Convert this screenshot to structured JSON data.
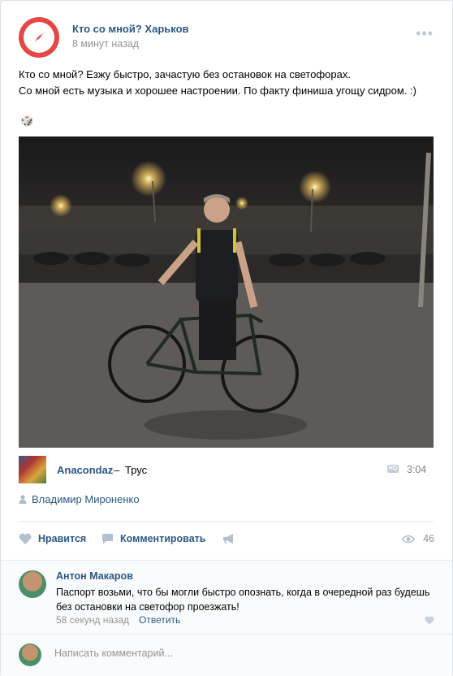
{
  "post": {
    "group_name": "Кто со мной? Харьков",
    "time": "8 минут назад",
    "more": "•••",
    "text_line1": "Кто со мной? Езжу быстро, зачастую без остановок на светофорах.",
    "text_line2": "Со мной есть музыка и хорошее настроении. По факту финиша угощу сидром. :)",
    "emoji": "🎲"
  },
  "audio": {
    "artist": "Anacondaz",
    "separator": "–",
    "title": "Трус",
    "badge": "HQ",
    "duration": "3:04"
  },
  "author": {
    "name": "Владимир Мироненко"
  },
  "actions": {
    "like_label": "Нравится",
    "comment_label": "Комментировать",
    "views": "46"
  },
  "comment": {
    "author": "Антон Макаров",
    "text": "Паспорт возьми, что бы могли быстро опознать, когда в очередной раз будешь без остановки на светофор проезжать!",
    "time": "58 секунд назад",
    "reply_label": "Ответить"
  },
  "reply_box": {
    "placeholder": "Написать комментарий..."
  },
  "colors": {
    "link": "#2a5885",
    "group_logo": "#e64646",
    "muted": "#939393"
  }
}
